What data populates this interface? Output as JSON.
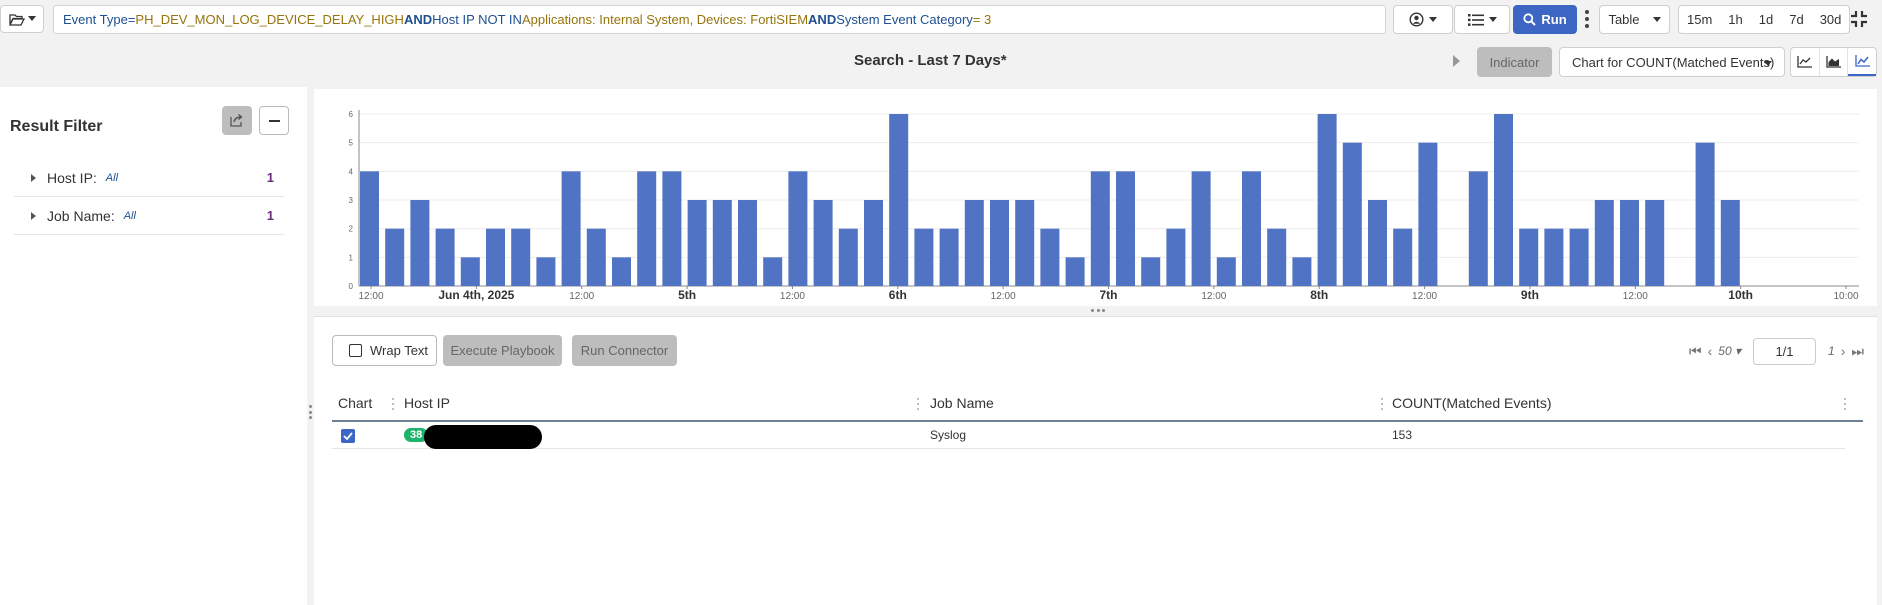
{
  "query": {
    "parts": [
      {
        "text": "Event Type",
        "kind": "key"
      },
      {
        "text": " = ",
        "kind": "key"
      },
      {
        "text": "PH_DEV_MON_LOG_DEVICE_DELAY_HIGH",
        "kind": "val"
      },
      {
        "text": " AND ",
        "kind": "op"
      },
      {
        "text": "Host IP NOT IN",
        "kind": "key"
      },
      {
        "text": " Applications: Internal System, Devices: FortiSIEM",
        "kind": "val"
      },
      {
        "text": " AND ",
        "kind": "op"
      },
      {
        "text": "System Event Category",
        "kind": "key"
      },
      {
        "text": " = 3",
        "kind": "val"
      }
    ]
  },
  "toolbar": {
    "folder_icon": "folder-open-icon",
    "user_icon": "user-circle-icon",
    "list_icon": "list-icon",
    "run_label": "Run",
    "display_select": "Table",
    "ranges": [
      "15m",
      "1h",
      "1d",
      "7d",
      "30d"
    ],
    "expand_icon": "compress-icon"
  },
  "header": {
    "title": "Search - Last 7 Days*",
    "indicator_label": "Indicator",
    "chart_select": "Chart for COUNT(Matched Events)",
    "chart_types": [
      "line-chart-icon",
      "area-chart-icon",
      "bar-chart-icon"
    ]
  },
  "result_filter": {
    "title": "Result Filter",
    "share_icon": "share-icon",
    "collapse_icon": "minus-icon",
    "filters": [
      {
        "label": "Host IP:",
        "value": "All",
        "count": "1"
      },
      {
        "label": "Job Name:",
        "value": "All",
        "count": "1"
      }
    ]
  },
  "chart_data": {
    "type": "bar",
    "y_ticks": [
      "0",
      "1",
      "2",
      "3",
      "4",
      "5",
      "6"
    ],
    "ylim": [
      0,
      6
    ],
    "x_labels": [
      "12:00",
      "Jun 4th, 2025",
      "12:00",
      "5th",
      "12:00",
      "6th",
      "12:00",
      "7th",
      "12:00",
      "8th",
      "12:00",
      "9th",
      "12:00",
      "10th",
      "10:00"
    ],
    "x_label_bold": [
      false,
      true,
      false,
      true,
      false,
      true,
      false,
      true,
      false,
      true,
      false,
      true,
      false,
      true,
      false
    ],
    "values": [
      4,
      2,
      3,
      2,
      1,
      2,
      2,
      1,
      4,
      2,
      1,
      4,
      4,
      3,
      3,
      3,
      1,
      4,
      3,
      2,
      3,
      6,
      2,
      2,
      3,
      3,
      3,
      2,
      1,
      4,
      4,
      1,
      2,
      4,
      1,
      4,
      2,
      1,
      6,
      5,
      3,
      2,
      5,
      0,
      4,
      6,
      2,
      2,
      2,
      3,
      3,
      3,
      0,
      5,
      3
    ],
    "color": "#5073c4",
    "grid": true
  },
  "table": {
    "wrap_text": "Wrap Text",
    "execute_playbook": "Execute Playbook",
    "run_connector": "Run Connector",
    "page_size": "50",
    "page_value": "1/1",
    "total_pages": "1",
    "columns": [
      "Chart",
      "Host IP",
      "Job Name",
      "COUNT(Matched Events)"
    ],
    "rows": [
      {
        "chart_checked": true,
        "host_ip_prefix": "38",
        "job_name": "Syslog",
        "count": "153"
      }
    ]
  }
}
